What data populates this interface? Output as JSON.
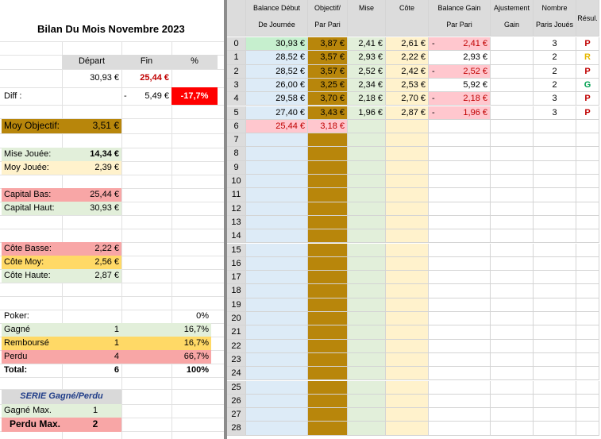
{
  "title": "Bilan Du Mois Novembre 2023",
  "summary": {
    "depart_label": "Départ",
    "fin_label": "Fin",
    "pct_label": "%",
    "depart_value": "30,93 €",
    "fin_value": "25,44 €",
    "diff_label": "Diff :",
    "diff_sign": "-",
    "diff_value": "5,49 €",
    "diff_pct": "-17,7%"
  },
  "stats": {
    "moy_objectif_label": "Moy Objectif:",
    "moy_objectif_value": "3,51 €",
    "mise_jouee_label": "Mise Jouée:",
    "mise_jouee_value": "14,34 €",
    "moy_jouee_label": "Moy Jouée:",
    "moy_jouee_value": "2,39 €",
    "capital_bas_label": "Capital Bas:",
    "capital_bas_value": "25,44 €",
    "capital_haut_label": "Capital Haut:",
    "capital_haut_value": "30,93 €",
    "cote_basse_label": "Côte Basse:",
    "cote_basse_value": "2,22 €",
    "cote_moy_label": "Côte Moy:",
    "cote_moy_value": "2,56 €",
    "cote_haute_label": "Côte Haute:",
    "cote_haute_value": "2,87 €"
  },
  "results": {
    "poker_label": "Poker:",
    "poker_pct": "0%",
    "gagne_label": "Gagné",
    "gagne_count": "1",
    "gagne_pct": "16,7%",
    "rembourse_label": "Remboursé",
    "rembourse_count": "1",
    "rembourse_pct": "16,7%",
    "perdu_label": "Perdu",
    "perdu_count": "4",
    "perdu_pct": "66,7%",
    "total_label": "Total:",
    "total_count": "6",
    "total_pct": "100%"
  },
  "serie": {
    "title": "SERIE Gagné/Perdu",
    "gagne_max_label": "Gagné Max.",
    "gagne_max_value": "1",
    "perdu_max_label": "Perdu Max.",
    "perdu_max_value": "2"
  },
  "table": {
    "headers": {
      "balance_1": "Balance Début",
      "balance_2": "De Journée",
      "objectif_1": "Objectif/",
      "objectif_2": "Par Pari",
      "mise": "Mise",
      "cote": "Côte",
      "gain_1": "Balance Gain",
      "gain_2": "Par Pari",
      "ajust_1": "Ajustement",
      "ajust_2": "Gain",
      "nombre_1": "Nombre",
      "nombre_2": "Paris Joués",
      "result": "Résul."
    },
    "rows": [
      {
        "n": "0",
        "balance": "30,93 €",
        "objectif": "3,87 €",
        "mise": "2,41 €",
        "cote": "2,61 €",
        "gain_sign": "-",
        "gain": "2,41 €",
        "nombre": "3",
        "result": "P"
      },
      {
        "n": "1",
        "balance": "28,52 €",
        "objectif": "3,57 €",
        "mise": "2,93 €",
        "cote": "2,22 €",
        "gain_sign": "",
        "gain": "2,93 €",
        "nombre": "2",
        "result": "R"
      },
      {
        "n": "2",
        "balance": "28,52 €",
        "objectif": "3,57 €",
        "mise": "2,52 €",
        "cote": "2,42 €",
        "gain_sign": "-",
        "gain": "2,52 €",
        "nombre": "2",
        "result": "P"
      },
      {
        "n": "3",
        "balance": "26,00 €",
        "objectif": "3,25 €",
        "mise": "2,34 €",
        "cote": "2,53 €",
        "gain_sign": "",
        "gain": "5,92 €",
        "nombre": "2",
        "result": "G"
      },
      {
        "n": "4",
        "balance": "29,58 €",
        "objectif": "3,70 €",
        "mise": "2,18 €",
        "cote": "2,70 €",
        "gain_sign": "-",
        "gain": "2,18 €",
        "nombre": "3",
        "result": "P"
      },
      {
        "n": "5",
        "balance": "27,40 €",
        "objectif": "3,43 €",
        "mise": "1,96 €",
        "cote": "2,87 €",
        "gain_sign": "-",
        "gain": "1,96 €",
        "nombre": "3",
        "result": "P"
      },
      {
        "n": "6",
        "balance": "25,44 €",
        "objectif": "3,18 €",
        "mise": "",
        "cote": "",
        "gain_sign": "",
        "gain": "",
        "nombre": "",
        "result": ""
      },
      {
        "n": "7"
      },
      {
        "n": "8"
      },
      {
        "n": "9"
      },
      {
        "n": "10"
      },
      {
        "n": "11"
      },
      {
        "n": "12"
      },
      {
        "n": "13"
      },
      {
        "n": "14"
      },
      {
        "n": "15"
      },
      {
        "n": "16"
      },
      {
        "n": "17"
      },
      {
        "n": "18"
      },
      {
        "n": "19"
      },
      {
        "n": "20"
      },
      {
        "n": "21"
      },
      {
        "n": "22"
      },
      {
        "n": "23"
      },
      {
        "n": "24"
      },
      {
        "n": "25"
      },
      {
        "n": "26"
      },
      {
        "n": "27"
      },
      {
        "n": "28"
      }
    ]
  },
  "colors": {
    "header_bg": "#dcdcdc",
    "gold": "#b8860b",
    "gold_light": "#ffd966",
    "green": "#e2efda",
    "green_strong": "#c6efce",
    "red": "#f8a6a6",
    "red_light": "#ffc7ce",
    "yellow": "#fff2cc",
    "blue": "#ddebf7",
    "alert_red": "#ff0000",
    "result_P": "#c00000",
    "result_R": "#e6b800",
    "result_G": "#00a050"
  }
}
